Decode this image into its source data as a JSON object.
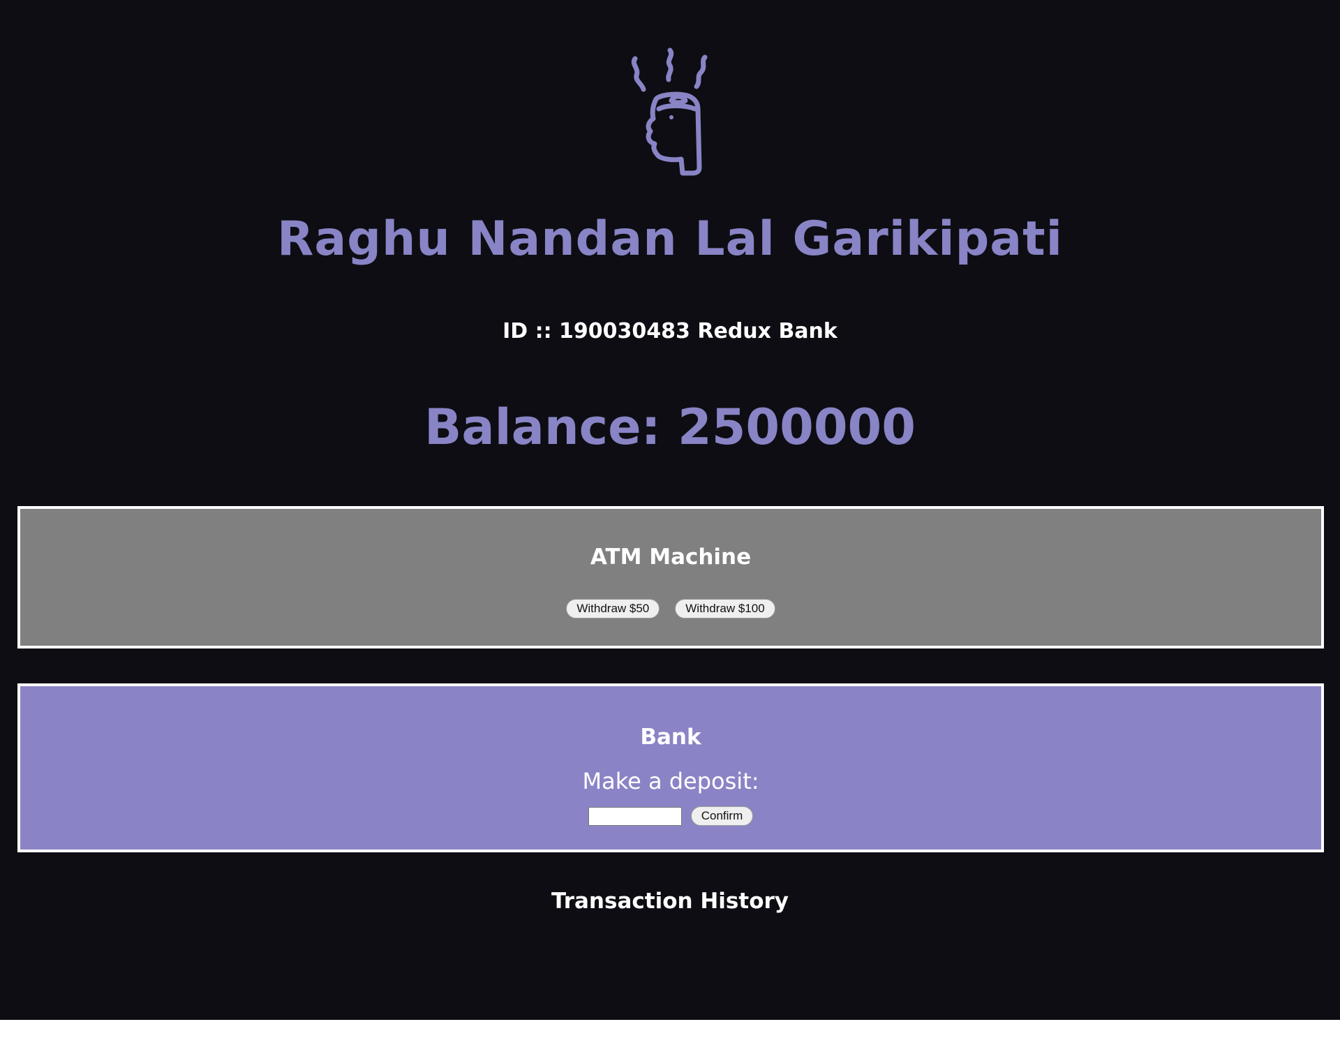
{
  "profile": {
    "avatar_icon": "steaming-head-icon",
    "name": "Raghu Nandan Lal Garikipati",
    "id_line": "ID :: 190030483 Redux Bank",
    "balance_text": "Balance: 2500000"
  },
  "atm": {
    "title": "ATM Machine",
    "withdraw_50_label": "Withdraw $50",
    "withdraw_100_label": "Withdraw $100"
  },
  "bank": {
    "title": "Bank",
    "deposit_label": "Make a deposit:",
    "deposit_value": "",
    "confirm_label": "Confirm"
  },
  "history": {
    "title": "Transaction History",
    "items": []
  },
  "colors": {
    "page_background": "#0d0d13",
    "accent": "#8884c5",
    "atm_panel": "#808080",
    "bank_panel": "#8a84c6"
  }
}
